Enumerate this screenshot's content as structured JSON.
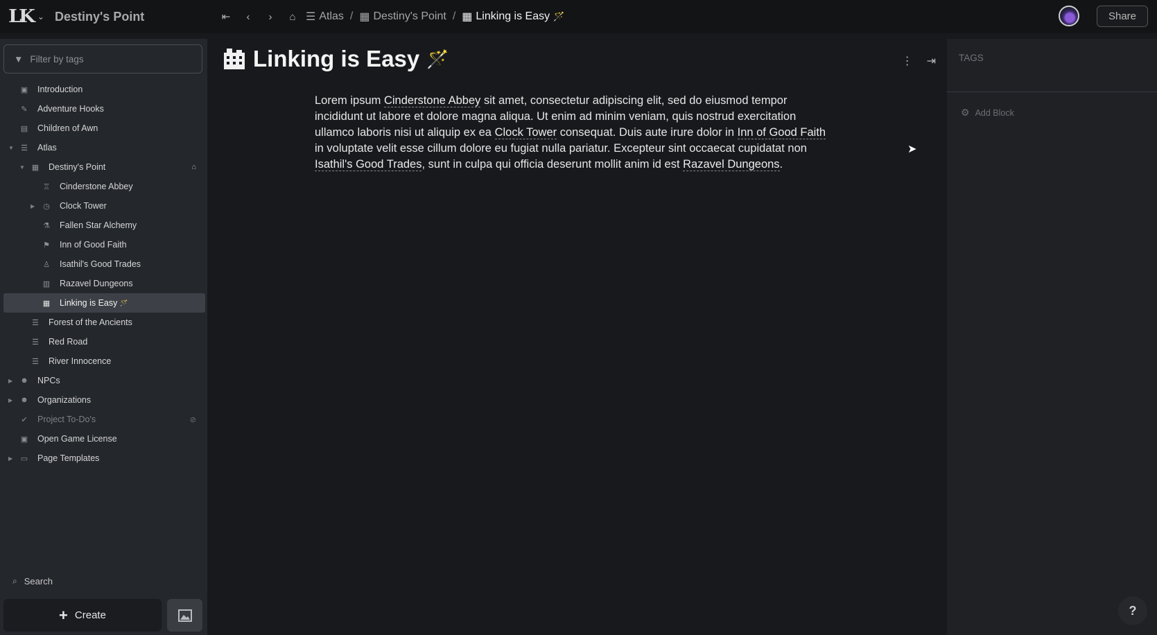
{
  "app": {
    "logo_text": "LK",
    "campaign_title": "Destiny's Point",
    "share_label": "Share"
  },
  "breadcrumbs": [
    {
      "label": "Atlas",
      "icon": "signpost-icon"
    },
    {
      "label": "Destiny's Point",
      "icon": "city-icon"
    },
    {
      "label": "Linking is Easy",
      "icon": "city-icon",
      "emoji": "🪄"
    }
  ],
  "sidebar": {
    "filter_placeholder": "Filter by tags",
    "items": [
      {
        "label": "Introduction",
        "icon": "book-icon"
      },
      {
        "label": "Adventure Hooks",
        "icon": "pin-icon"
      },
      {
        "label": "Children of Awn",
        "icon": "scroll-icon"
      },
      {
        "label": "Atlas",
        "icon": "signpost-icon"
      },
      {
        "label": "Destiny's Point",
        "icon": "city-icon"
      },
      {
        "label": "Cinderstone Abbey",
        "icon": "abbey-icon"
      },
      {
        "label": "Clock Tower",
        "icon": "clock-icon"
      },
      {
        "label": "Fallen Star Alchemy",
        "icon": "flask-icon"
      },
      {
        "label": "Inn of Good Faith",
        "icon": "flag-icon"
      },
      {
        "label": "Isathil's Good Trades",
        "icon": "bag-icon"
      },
      {
        "label": "Razavel Dungeons",
        "icon": "dungeon-icon"
      },
      {
        "label": "Linking is Easy",
        "icon": "city-icon",
        "emoji": "🪄"
      },
      {
        "label": "Forest of the Ancients",
        "icon": "signpost-icon"
      },
      {
        "label": "Red Road",
        "icon": "signpost-icon"
      },
      {
        "label": "River Innocence",
        "icon": "signpost-icon"
      },
      {
        "label": "NPCs",
        "icon": "users-icon"
      },
      {
        "label": "Organizations",
        "icon": "users-icon"
      },
      {
        "label": "Project To-Do's",
        "icon": "check-circle-icon"
      },
      {
        "label": "Open Game License",
        "icon": "book-icon"
      },
      {
        "label": "Page Templates",
        "icon": "folder-icon"
      }
    ],
    "search_label": "Search",
    "create_label": "Create"
  },
  "page": {
    "title": "Linking is Easy",
    "title_emoji": "🪄",
    "body": {
      "p1": "Lorem ipsum ",
      "link1": "Cinderstone Abbey",
      "p2": " sit amet, consectetur adipiscing elit, sed do eiusmod tempor incididunt ut labore et dolore magna aliqua. Ut enim ad minim veniam, quis nostrud exercitation ullamco laboris nisi ut aliquip ex ea ",
      "link2": "Clock Tower",
      "p3": " consequat. Duis aute irure dolor in ",
      "link3": "Inn of Good Faith",
      "p4": " in voluptate velit esse cillum dolore eu fugiat nulla pariatur. Excepteur sint occaecat cupidatat non ",
      "link4": "Isathil's Good Trades",
      "p5": ", sunt in culpa qui officia deserunt mollit anim id est ",
      "link5": "Razavel Dungeons",
      "p6": "."
    }
  },
  "right_panel": {
    "tags_label": "TAGS",
    "add_block_label": "Add Block"
  },
  "help_label": "?"
}
